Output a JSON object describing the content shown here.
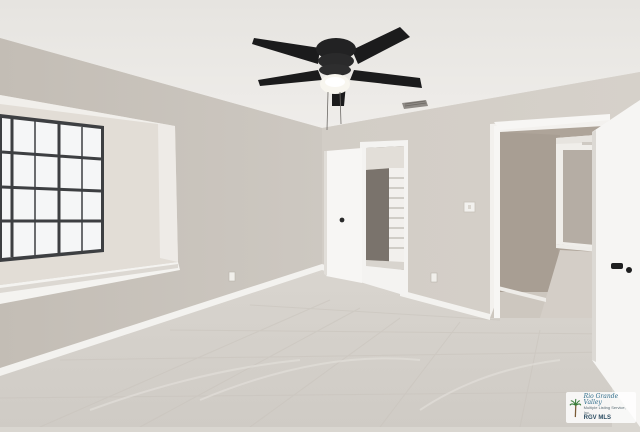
{
  "watermark": {
    "line1": "Rio Grande Valley",
    "line2": "Multiple Listing Service, Inc.",
    "line3": "RGV MLS"
  },
  "colors": {
    "ceiling": "#e9e7e3",
    "wall_left": "#cbc5bd",
    "wall_back": "#d7d2cb",
    "floor": "#d6d2cc",
    "window_glass": "#f4f5f6",
    "fan_blade": "#1b1b1c",
    "baseboard": "#f3f2ef"
  }
}
